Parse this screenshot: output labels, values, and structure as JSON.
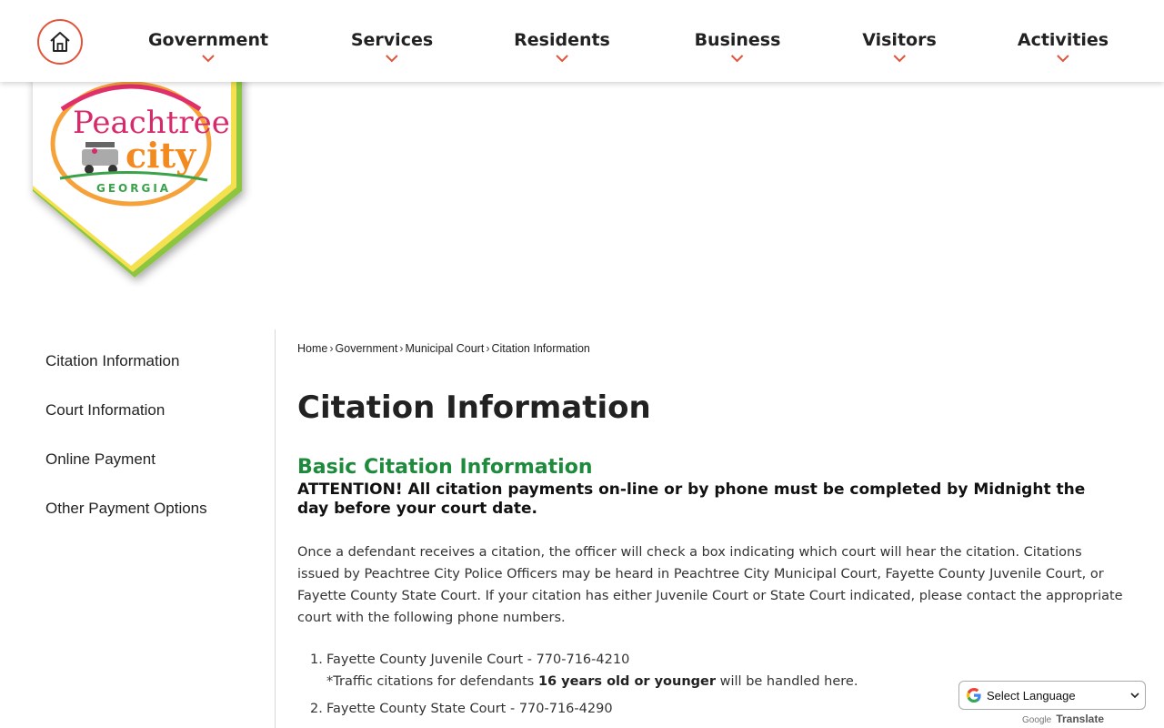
{
  "header": {
    "nav": [
      {
        "label": "Government"
      },
      {
        "label": "Services"
      },
      {
        "label": "Residents"
      },
      {
        "label": "Business"
      },
      {
        "label": "Visitors"
      },
      {
        "label": "Activities"
      }
    ]
  },
  "logo": {
    "line1": "Peachtree",
    "line2": "city",
    "line3": "GEORGIA"
  },
  "sidebar": {
    "items": [
      {
        "label": "Citation Information"
      },
      {
        "label": "Court Information"
      },
      {
        "label": "Online Payment"
      },
      {
        "label": "Other Payment Options"
      }
    ]
  },
  "breadcrumb": {
    "items": [
      "Home",
      "Government",
      "Municipal Court",
      "Citation Information"
    ],
    "separator": "›"
  },
  "main": {
    "title": "Citation Information",
    "section_title": "Basic Citation Information",
    "attention": "ATTENTION! All citation payments on-line or by phone must be completed by Midnight the day before your court date.",
    "paragraph": "Once a defendant receives a citation, the officer will check a box indicating which court will hear the citation. Citations issued by Peachtree City Police Officers may be heard in Peachtree City Municipal Court, Fayette County Juvenile Court, or Fayette County State Court. If your citation has either Juvenile Court or State Court indicated, please contact the appropriate court with the following phone numbers.",
    "list": [
      {
        "num": "1.",
        "text": "Fayette County Juvenile Court - 770-716-4210",
        "note_pre": "*Traffic citations for defendants ",
        "note_bold": "16 years old or younger",
        "note_post": " will be handled here."
      },
      {
        "num": "2.",
        "text": "Fayette County State Court - 770-716-4290"
      }
    ]
  },
  "translate": {
    "select_label": "Select Language",
    "powered_google": "Google",
    "powered_translate": "Translate"
  },
  "colors": {
    "accent_orange": "#e1553c",
    "section_green": "#1e8a3c"
  }
}
